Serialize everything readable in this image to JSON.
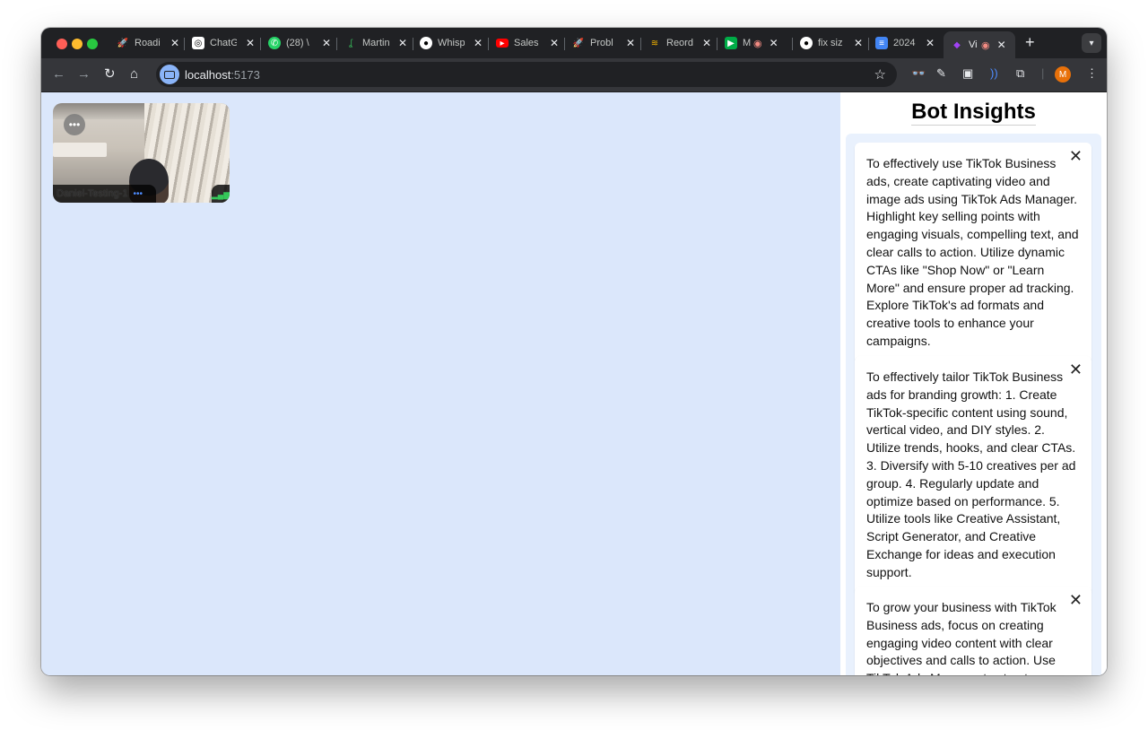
{
  "browser": {
    "tabs": [
      {
        "title": "Roadi",
        "icon": "rocket-icon",
        "color": "#5f6368"
      },
      {
        "title": "ChatG",
        "icon": "openai-icon",
        "color": "#5f6368"
      },
      {
        "title": "(28) \\",
        "icon": "whatsapp-icon",
        "color": "#25d366"
      },
      {
        "title": "Martin",
        "icon": "leaf-icon",
        "color": "#34a853"
      },
      {
        "title": "Whisp",
        "icon": "github-icon",
        "color": "#ffffff"
      },
      {
        "title": "Sales",
        "icon": "youtube-icon",
        "color": "#ff0000"
      },
      {
        "title": "Probl",
        "icon": "rocket-icon",
        "color": "#5f6368"
      },
      {
        "title": "Reord",
        "icon": "stack-icon",
        "color": "#f4b400"
      },
      {
        "title": "M",
        "icon": "meet-icon",
        "color": "#00ac47"
      },
      {
        "title": "fix siz",
        "icon": "github-icon",
        "color": "#ffffff"
      },
      {
        "title": "2024",
        "icon": "docs-icon",
        "color": "#4285f4"
      },
      {
        "title": "Vi",
        "icon": "gem-icon",
        "color": "#a142f4"
      }
    ],
    "close_glyph": "✕",
    "new_tab_glyph": "+",
    "url_host": "localhost",
    "url_port": ":5173",
    "profile_initial": "M"
  },
  "video": {
    "participant_name": "Daniel-Testing-1",
    "more_glyph": "•••",
    "signal_glyph": "▂▄▆"
  },
  "panel": {
    "title": "Bot Insights",
    "close_glyph": "✕",
    "insights": [
      "To effectively use TikTok Business ads, create captivating video and image ads using TikTok Ads Manager. Highlight key selling points with engaging visuals, compelling text, and clear calls to action. Utilize dynamic CTAs like \"Shop Now\" or \"Learn More\" and ensure proper ad tracking. Explore TikTok's ad formats and creative tools to enhance your campaigns.",
      "To effectively tailor TikTok Business ads for branding growth: 1. Create TikTok-specific content using sound, vertical video, and DIY styles. 2. Utilize trends, hooks, and clear CTAs. 3. Diversify with 5-10 creatives per ad group. 4. Regularly update and optimize based on performance. 5. Utilize tools like Creative Assistant, Script Generator, and Creative Exchange for ideas and execution support.",
      "To grow your business with TikTok Business ads, focus on creating engaging video content with clear objectives and calls to action. Use TikTok Ads Manager to structure"
    ]
  }
}
